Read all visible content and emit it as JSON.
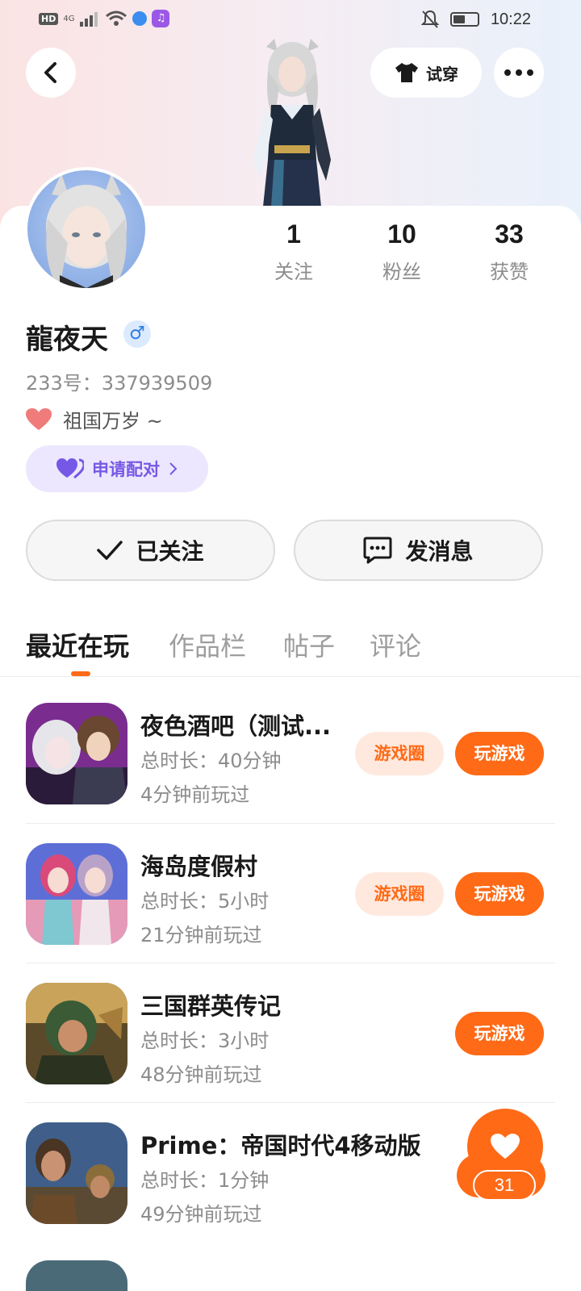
{
  "status_bar": {
    "hd": "HD",
    "network": "4G",
    "time": "10:22"
  },
  "header": {
    "tryon_label": "试穿"
  },
  "stats": [
    {
      "value": "1",
      "label": "关注"
    },
    {
      "value": "10",
      "label": "粉丝"
    },
    {
      "value": "33",
      "label": "获赞"
    }
  ],
  "profile": {
    "name": "龍夜天",
    "gender_symbol": "♂",
    "id_text": "233号：337939509",
    "motto": "祖国万岁 ~",
    "pair_label": "申请配对"
  },
  "actions": {
    "follow_label": "已关注",
    "message_label": "发消息"
  },
  "tabs": [
    "最近在玩",
    "作品栏",
    "帖子",
    "评论"
  ],
  "games": [
    {
      "name": "夜色酒吧（测试...",
      "duration": "总时长：40分钟",
      "last_played": "4分钟前玩过",
      "circle_label": "游戏圈",
      "play_label": "玩游戏"
    },
    {
      "name": "海岛度假村",
      "duration": "总时长：5小时",
      "last_played": "21分钟前玩过",
      "circle_label": "游戏圈",
      "play_label": "玩游戏"
    },
    {
      "name": "三国群英传记",
      "duration": "总时长：3小时",
      "last_played": "48分钟前玩过",
      "play_label": "玩游戏"
    },
    {
      "name": "Prime：帝国时代4移动版",
      "duration": "总时长：1分钟",
      "last_played": "49分钟前玩过"
    }
  ],
  "like_fab": {
    "count": "31"
  },
  "colors": {
    "accent": "#ff6a17",
    "pair": "#7658e6",
    "gender": "#2f7de1"
  }
}
